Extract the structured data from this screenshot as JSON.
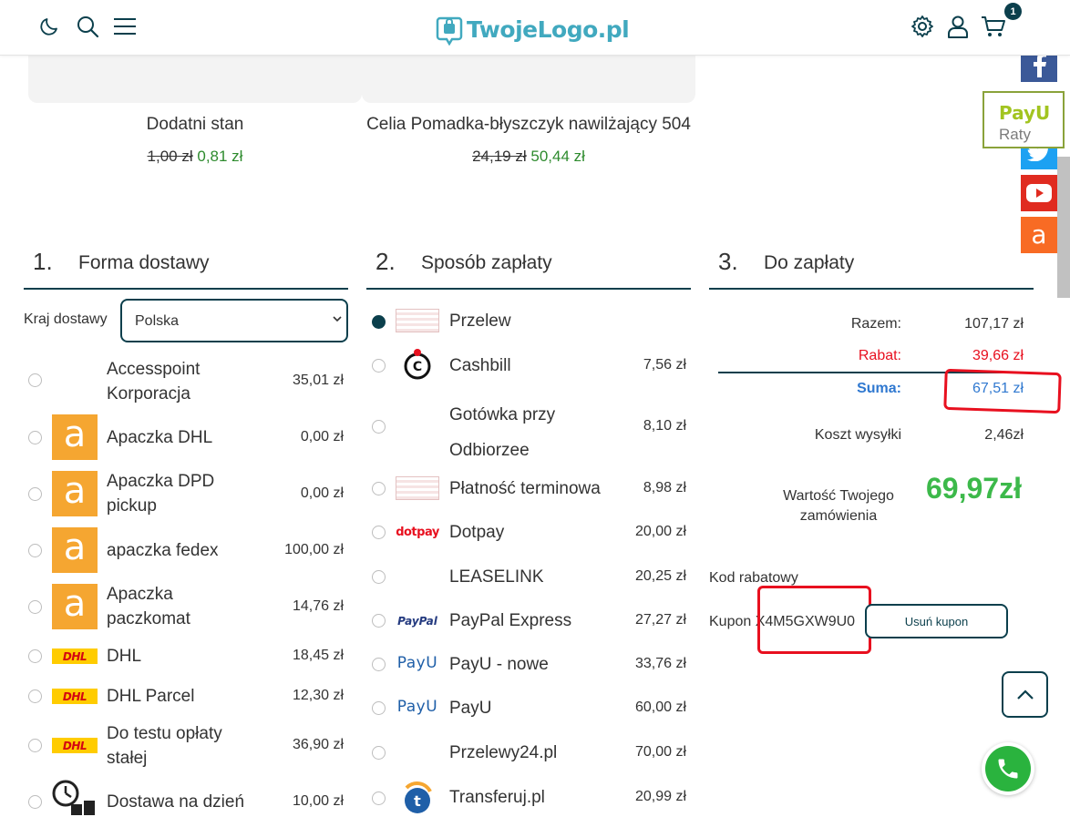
{
  "header": {
    "logo_text": "TwojeLogo.pl",
    "cart_count": "1"
  },
  "products": [
    {
      "name": "Dodatni stan",
      "old_price": "1,00 zł",
      "new_price": "0,81 zł"
    },
    {
      "name": "Celia Pomadka-błyszczyk nawilżający 504",
      "old_price": "24,19 zł",
      "new_price": "50,44 zł"
    }
  ],
  "sections": {
    "delivery": {
      "num": "1.",
      "title": "Forma dostawy"
    },
    "payment": {
      "num": "2.",
      "title": "Sposób zapłaty"
    },
    "total": {
      "num": "3.",
      "title": "Do zapłaty"
    }
  },
  "delivery": {
    "country_label": "Kraj dostawy",
    "country_value": "Polska",
    "options": [
      {
        "name": "Accesspoint Korporacja",
        "price": "35,01 zł",
        "logo": "none"
      },
      {
        "name": "Apaczka DHL",
        "price": "0,00 zł",
        "logo": "apaczka-icon"
      },
      {
        "name": "Apaczka DPD pickup",
        "price": "0,00 zł",
        "logo": "apaczka-icon"
      },
      {
        "name": "apaczka fedex",
        "price": "100,00 zł",
        "logo": "apaczka-icon"
      },
      {
        "name": "Apaczka paczkomat",
        "price": "14,76 zł",
        "logo": "apaczka-icon"
      },
      {
        "name": "DHL",
        "price": "18,45 zł",
        "logo": "dhl-icon"
      },
      {
        "name": "DHL Parcel",
        "price": "12,30 zł",
        "logo": "dhl-icon"
      },
      {
        "name": "Do testu opłaty stałej",
        "price": "36,90 zł",
        "logo": "dhl-icon"
      },
      {
        "name": "Dostawa na dzień",
        "price": "10,00 zł",
        "logo": "clock-icon"
      }
    ]
  },
  "payment": {
    "options": [
      {
        "name": "Przelew",
        "price": "",
        "logo": "transfer-icon",
        "selected": true
      },
      {
        "name": "Cashbill",
        "price": "7,56 zł",
        "logo": "cashbill-icon"
      },
      {
        "name": "Gotówka przy Odbiorzee",
        "price": "8,10 zł",
        "logo": "none"
      },
      {
        "name": "Płatność terminowa",
        "price": "8,98 zł",
        "logo": "transfer-icon"
      },
      {
        "name": "Dotpay",
        "price": "20,00 zł",
        "logo": "dotpay-icon"
      },
      {
        "name": "LEASELINK",
        "price": "20,25 zł",
        "logo": "none"
      },
      {
        "name": "PayPal Express",
        "price": "27,27 zł",
        "logo": "paypal-icon"
      },
      {
        "name": "PayU - nowe",
        "price": "33,76 zł",
        "logo": "payu-icon"
      },
      {
        "name": "PayU",
        "price": "60,00 zł",
        "logo": "payu-icon"
      },
      {
        "name": "Przelewy24.pl",
        "price": "70,00 zł",
        "logo": "none"
      },
      {
        "name": "Transferuj.pl",
        "price": "20,99 zł",
        "logo": "transferuj-icon"
      }
    ],
    "logo_texts": {
      "dotpay": "dotpay",
      "paypal": "PayPal",
      "payu": "PayU",
      "cashbill": "C",
      "transferuj": "t"
    }
  },
  "summary": {
    "subtotal_label": "Razem:",
    "subtotal": "107,17 zł",
    "discount_label": "Rabat:",
    "discount": "39,66 zł",
    "sum_label": "Suma:",
    "sum": "67,51 zł",
    "shipping_label": "Koszt wysyłki",
    "shipping": "2,46zł",
    "order_value_label": "Wartość Twojego zamówienia",
    "order_value": "69,97zł",
    "colors": {
      "discount": "#e8101f",
      "sum": "#2f78d0",
      "total": "#3cb94a"
    }
  },
  "coupon": {
    "label": "Kod rabatowy",
    "text": "Kupon X4M5GXW9U0",
    "remove_label": "Usuń kupon"
  },
  "sidebar_widget": {
    "payu_text": "PayU",
    "raty_text": "Raty"
  },
  "social_icons": [
    "facebook-icon",
    "twitter-icon",
    "youtube-icon",
    "allegro-icon"
  ],
  "brand_colors": {
    "primary": "#0b3f4c",
    "accent": "#41a9bf",
    "price_green": "#2e8b2e"
  }
}
